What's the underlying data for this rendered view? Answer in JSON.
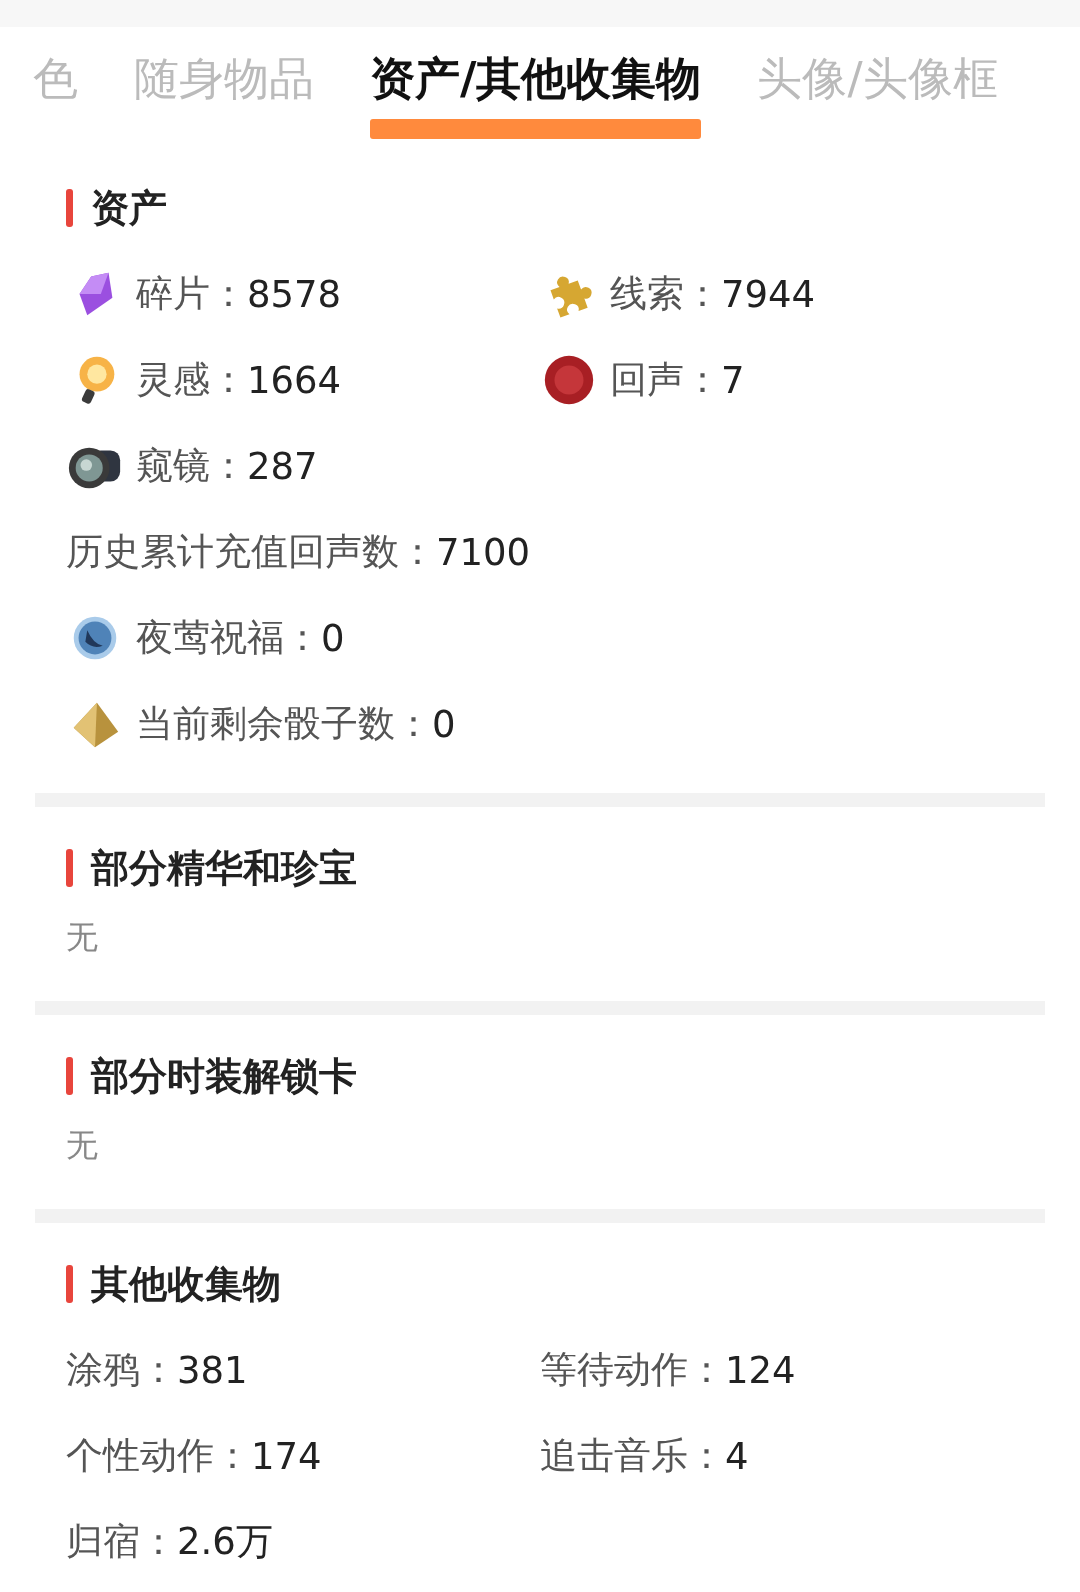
{
  "tabs": [
    {
      "label": "色",
      "selected": false
    },
    {
      "label": "随身物品",
      "selected": false
    },
    {
      "label": "资产/其他收集物",
      "selected": true
    },
    {
      "label": "头像/头像框",
      "selected": false
    }
  ],
  "sections": [
    {
      "title": "资产",
      "items": [
        {
          "label": "碎片：",
          "value": "8578",
          "icon": true,
          "wide": false
        },
        {
          "label": "线索：",
          "value": "7944",
          "icon": true,
          "wide": false
        },
        {
          "label": "灵感：",
          "value": "1664",
          "icon": true,
          "wide": false
        },
        {
          "label": "回声：",
          "value": "7",
          "icon": true,
          "wide": false
        },
        {
          "label": "窥镜：",
          "value": "287",
          "icon": true,
          "wide": true
        },
        {
          "label": "历史累计充值回声数：",
          "value": "7100",
          "icon": false,
          "wide": true
        },
        {
          "label": "夜莺祝福：",
          "value": "0",
          "icon": true,
          "wide": true
        },
        {
          "label": "当前剩余骰子数：",
          "value": "0",
          "icon": true,
          "wide": true
        }
      ]
    },
    {
      "title": "部分精华和珍宝",
      "empty": "无"
    },
    {
      "title": "部分时装解锁卡",
      "empty": "无"
    },
    {
      "title": "其他收集物",
      "items": [
        {
          "label": "涂鸦：",
          "value": "381",
          "icon": false,
          "wide": false
        },
        {
          "label": "等待动作：",
          "value": "124",
          "icon": false,
          "wide": false
        },
        {
          "label": "个性动作：",
          "value": "174",
          "icon": false,
          "wide": false
        },
        {
          "label": "追击音乐：",
          "value": "4",
          "icon": false,
          "wide": false
        },
        {
          "label": "归宿：",
          "value": "2.6万",
          "icon": false,
          "wide": true
        }
      ]
    }
  ]
}
